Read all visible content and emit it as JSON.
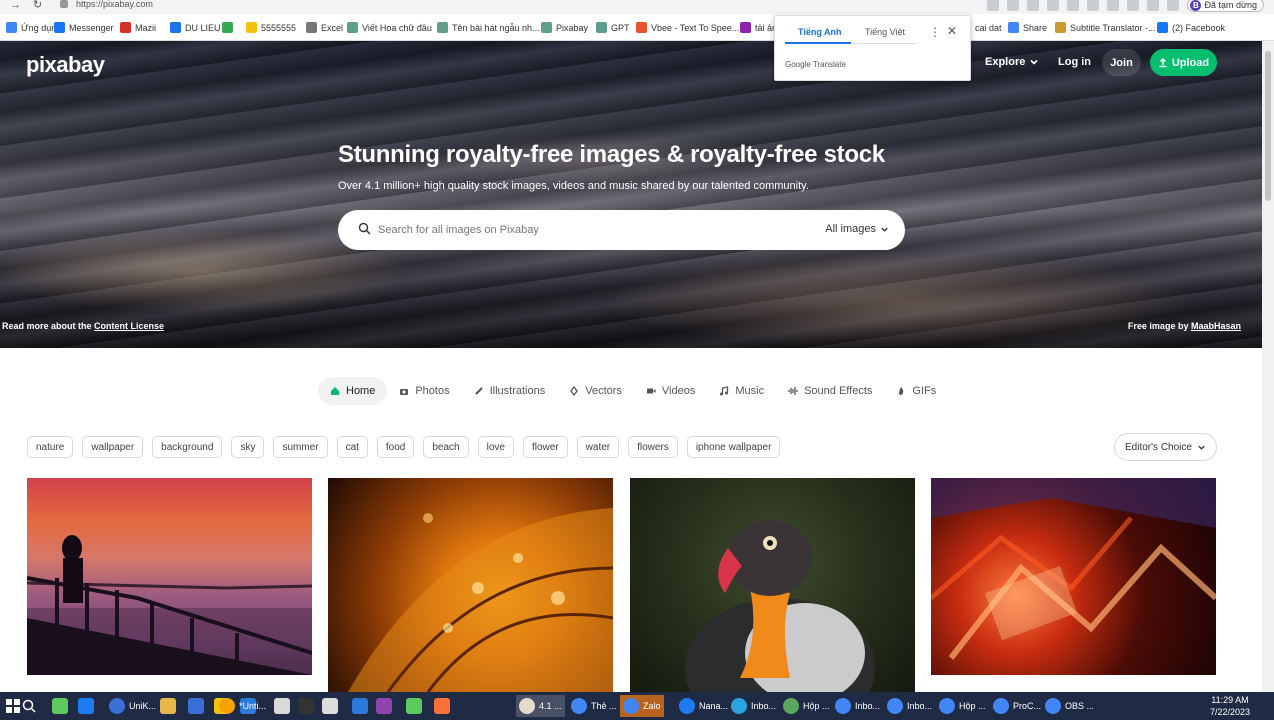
{
  "browser": {
    "url": "https://pixabay.com",
    "profile_label": "Đã tạm dừng",
    "profile_initial": "B"
  },
  "bookmarks": [
    {
      "label": "Ứng dụng",
      "color": "#4285f4"
    },
    {
      "label": "Messenger",
      "color": "#1877f2"
    },
    {
      "label": "Mazii",
      "color": "#d93025"
    },
    {
      "label": "DU LIEU",
      "color": "#1a73e8"
    },
    {
      "label": "",
      "color": "#34a853"
    },
    {
      "label": "5555555",
      "color": "#f4c20d"
    },
    {
      "label": "Excel",
      "color": "#777"
    },
    {
      "label": "Viết Hoa chữ đầu",
      "color": "#5f9e8a"
    },
    {
      "label": "Tên bài hát ngẫu nh...",
      "color": "#5f9e8a"
    },
    {
      "label": "Pixabay",
      "color": "#5f9e8a"
    },
    {
      "label": "GPT",
      "color": "#5f9e8a"
    },
    {
      "label": "Vbee - Text To Spee...",
      "color": "#e8542e"
    },
    {
      "label": "tải ản",
      "color": "#8e24aa"
    },
    {
      "label": "cai dat",
      "color": "#777"
    },
    {
      "label": "Share",
      "color": "#4285f4"
    },
    {
      "label": "Subtitle Translator -...",
      "color": "#c99a2e"
    },
    {
      "label": "(2) Facebook",
      "color": "#1877f2"
    }
  ],
  "translate_popup": {
    "tab_active": "Tiếng Anh",
    "tab_other": "Tiếng Việt",
    "brand": "Google Translate"
  },
  "header": {
    "logo": "pixabay",
    "explore": "Explore",
    "login": "Log in",
    "join": "Join",
    "upload": "Upload"
  },
  "hero": {
    "title": "Stunning royalty-free images & royalty-free stock",
    "subtitle": "Over 4.1 million+ high quality stock images, videos and music shared by our talented community.",
    "search_placeholder": "Search for all images on Pixabay",
    "search_scope": "All images",
    "license_prefix": "Read more about the",
    "license_link": "Content License",
    "credit_prefix": "Free image by",
    "credit_author": "MaabHasan"
  },
  "categories": [
    {
      "label": "Home",
      "icon": "home-icon",
      "active": true
    },
    {
      "label": "Photos",
      "icon": "camera-icon"
    },
    {
      "label": "Illustrations",
      "icon": "brush-icon"
    },
    {
      "label": "Vectors",
      "icon": "pen-icon"
    },
    {
      "label": "Videos",
      "icon": "video-icon"
    },
    {
      "label": "Music",
      "icon": "music-icon"
    },
    {
      "label": "Sound Effects",
      "icon": "waveform-icon"
    },
    {
      "label": "GIFs",
      "icon": "flame-icon"
    }
  ],
  "tags": [
    "nature",
    "wallpaper",
    "background",
    "sky",
    "summer",
    "cat",
    "food",
    "beach",
    "love",
    "flower",
    "water",
    "flowers",
    "iphone wallpaper"
  ],
  "sort": "Editor's Choice",
  "taskbar": {
    "items": [
      "UniK...",
      "*Unti...",
      "4.1 ...",
      "Thẻ ...",
      "Zalo",
      "Nana...",
      "Inbo...",
      "Hộp ...",
      "Inbo...",
      "Inbo...",
      "Hộp ...",
      "ProC...",
      "OBS ..."
    ],
    "time": "11:29 AM",
    "date": "7/22/2023"
  },
  "colors": {
    "accent": "#02be6e",
    "link": "#1a73e8"
  }
}
